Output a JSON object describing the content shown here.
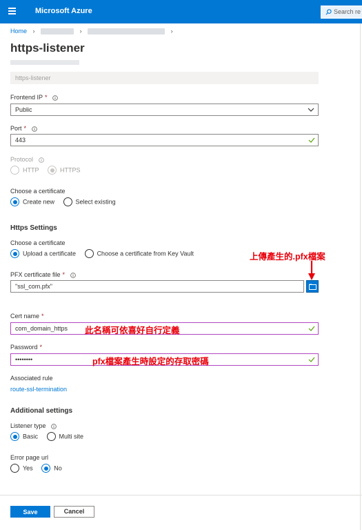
{
  "app": {
    "title": "Microsoft Azure",
    "search_placeholder": "Search re"
  },
  "breadcrumb": {
    "home": "Home"
  },
  "page": {
    "title": "https-listener",
    "name_value": "https-listener"
  },
  "frontend_ip": {
    "label": "Frontend IP",
    "value": "Public"
  },
  "port": {
    "label": "Port",
    "value": "443"
  },
  "protocol": {
    "label": "Protocol",
    "options": [
      "HTTP",
      "HTTPS"
    ],
    "selected": "HTTPS"
  },
  "certificate_choice": {
    "label": "Choose a certificate",
    "options": [
      "Create new",
      "Select existing"
    ],
    "selected": "Create new"
  },
  "https_settings": {
    "heading": "Https Settings",
    "choose_label": "Choose a certificate",
    "options": [
      "Upload a certificate",
      "Choose a certificate from Key Vault"
    ],
    "selected": "Upload a certificate"
  },
  "pfx": {
    "label": "PFX certificate file",
    "value": "\"ssl_com.pfx\""
  },
  "cert_name": {
    "label": "Cert name",
    "value": "com_domain_https"
  },
  "password": {
    "label": "Password",
    "value": "••••••••"
  },
  "associated_rule": {
    "label": "Associated rule",
    "link": "route-ssl-termination"
  },
  "additional": {
    "heading": "Additional settings",
    "listener_type_label": "Listener type",
    "listener_options": [
      "Basic",
      "Multi site"
    ],
    "listener_selected": "Basic",
    "error_page_label": "Error page url",
    "error_options": [
      "Yes",
      "No"
    ],
    "error_selected": "No"
  },
  "annotations": {
    "upload": "上傳產生的.pfx檔案",
    "cert_name": "此名稱可依喜好自行定義",
    "password": "pfx檔案產生時設定的存取密碼"
  },
  "buttons": {
    "save": "Save",
    "cancel": "Cancel"
  },
  "colors": {
    "accent": "#0078d4",
    "annotation": "#e8000b",
    "highlight_border": "#b146c2",
    "valid_check": "#57a300"
  }
}
